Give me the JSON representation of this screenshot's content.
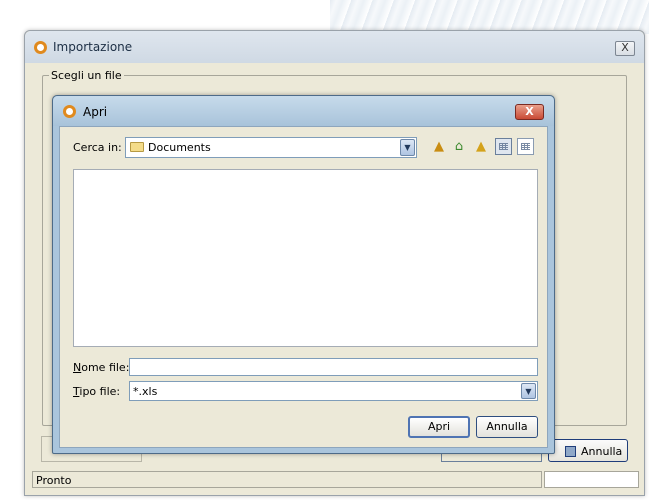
{
  "outer_window": {
    "title": "Importazione",
    "close_symbol": "X",
    "group_label": "Scegli un file",
    "cancel_label": "Annulla",
    "status_text": "Pronto"
  },
  "dialog": {
    "title": "Apri",
    "close_symbol": "X",
    "look_in_label": "Cerca in:",
    "look_in_value": "Documents",
    "filename_label": "Nome file:",
    "filename_value": "",
    "filetype_label": "Tipo file:",
    "filetype_value": "*.xls",
    "open_label": "Apri",
    "cancel_label": "Annulla",
    "toolbar_icons": [
      "up-one-level-icon",
      "home-icon",
      "new-folder-icon",
      "list-view-icon",
      "details-view-icon"
    ]
  },
  "colors": {
    "app_icon": "#e08a1e",
    "dialog_frame": "#aac5dc",
    "close_button": "#c94a35",
    "window_bg": "#ece9d8"
  }
}
